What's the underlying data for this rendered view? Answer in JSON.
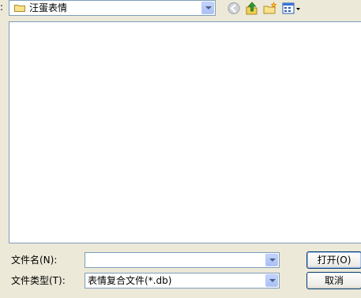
{
  "toolbar": {
    "look_in_colon": ":",
    "look_in_value": "汪蛋表情",
    "icons": [
      "folder-icon",
      "back-icon",
      "up-folder-icon",
      "new-folder-icon",
      "views-icon"
    ]
  },
  "fields": {
    "filename_label": "文件名(N):",
    "filename_value": "",
    "filetype_label": "文件类型(T):",
    "filetype_value": "表情复合文件(*.db)"
  },
  "buttons": {
    "open_label": "打开(O)",
    "cancel_label": "取消"
  },
  "colors": {
    "window_bg": "#ece9d8",
    "border": "#7f9db9",
    "button_border": "#003c74"
  }
}
